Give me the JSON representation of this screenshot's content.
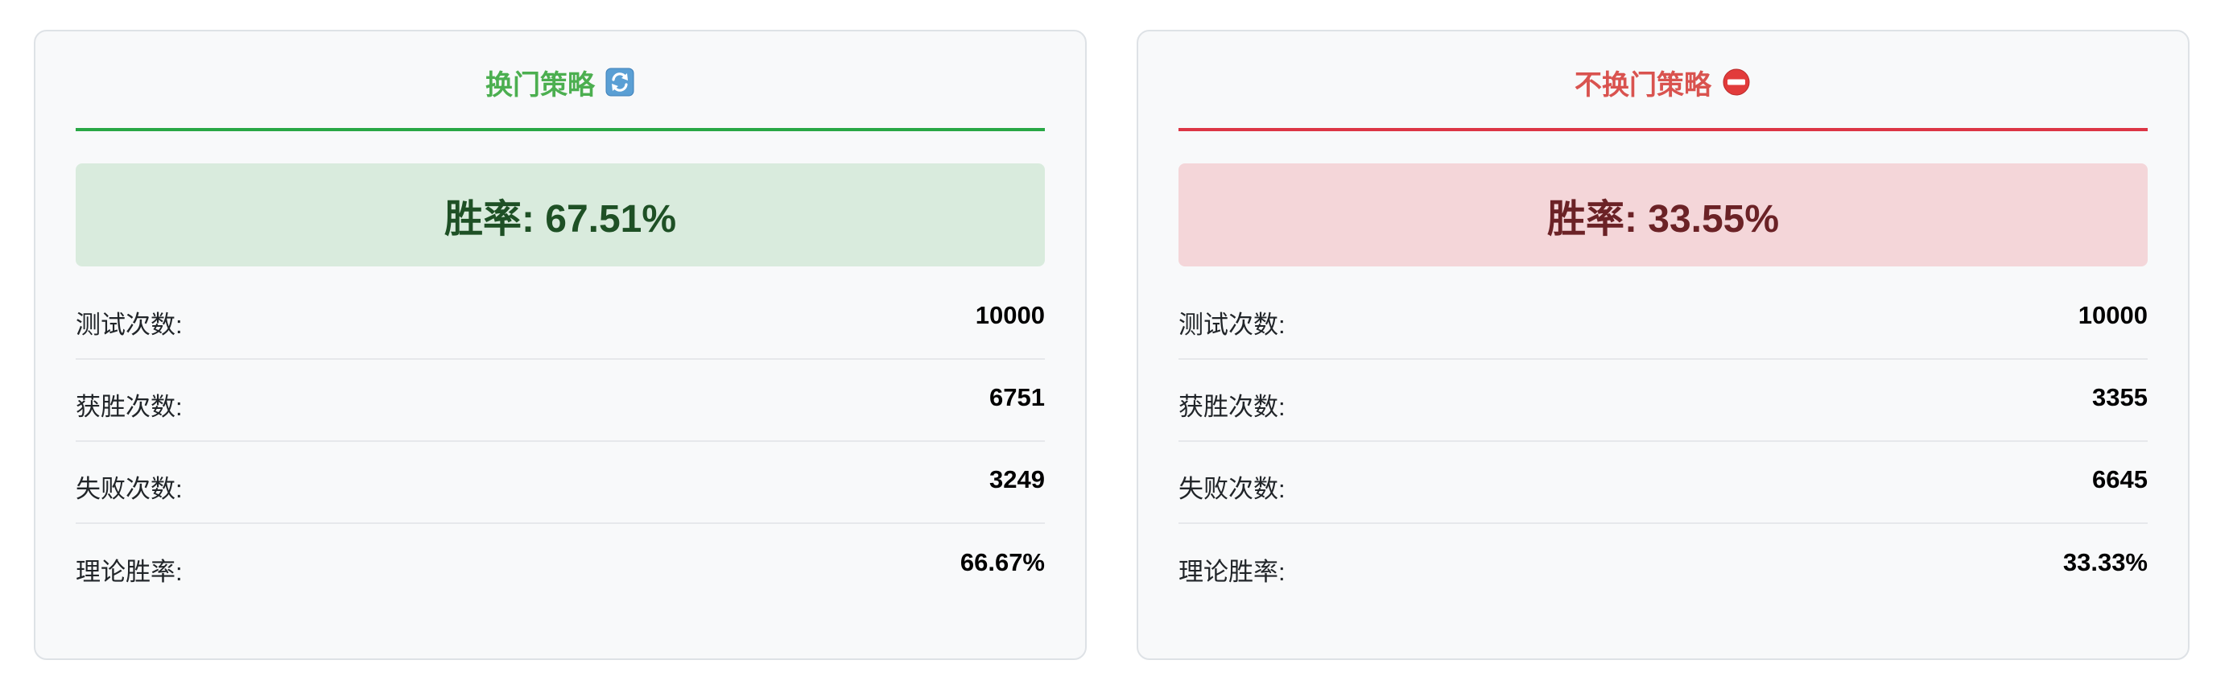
{
  "switch_card": {
    "title": "换门策略",
    "icon": "refresh-icon",
    "accent_color": "#28a745",
    "rate_text": "胜率: 67.51%",
    "stats": [
      {
        "label": "测试次数:",
        "value": "10000"
      },
      {
        "label": "获胜次数:",
        "value": "6751"
      },
      {
        "label": "失败次数:",
        "value": "3249"
      },
      {
        "label": "理论胜率:",
        "value": "66.67%"
      }
    ]
  },
  "stay_card": {
    "title": "不换门策略",
    "icon": "no-entry-icon",
    "accent_color": "#dc3545",
    "rate_text": "胜率: 33.55%",
    "stats": [
      {
        "label": "测试次数:",
        "value": "10000"
      },
      {
        "label": "获胜次数:",
        "value": "3355"
      },
      {
        "label": "失败次数:",
        "value": "6645"
      },
      {
        "label": "理论胜率:",
        "value": "33.33%"
      }
    ]
  }
}
